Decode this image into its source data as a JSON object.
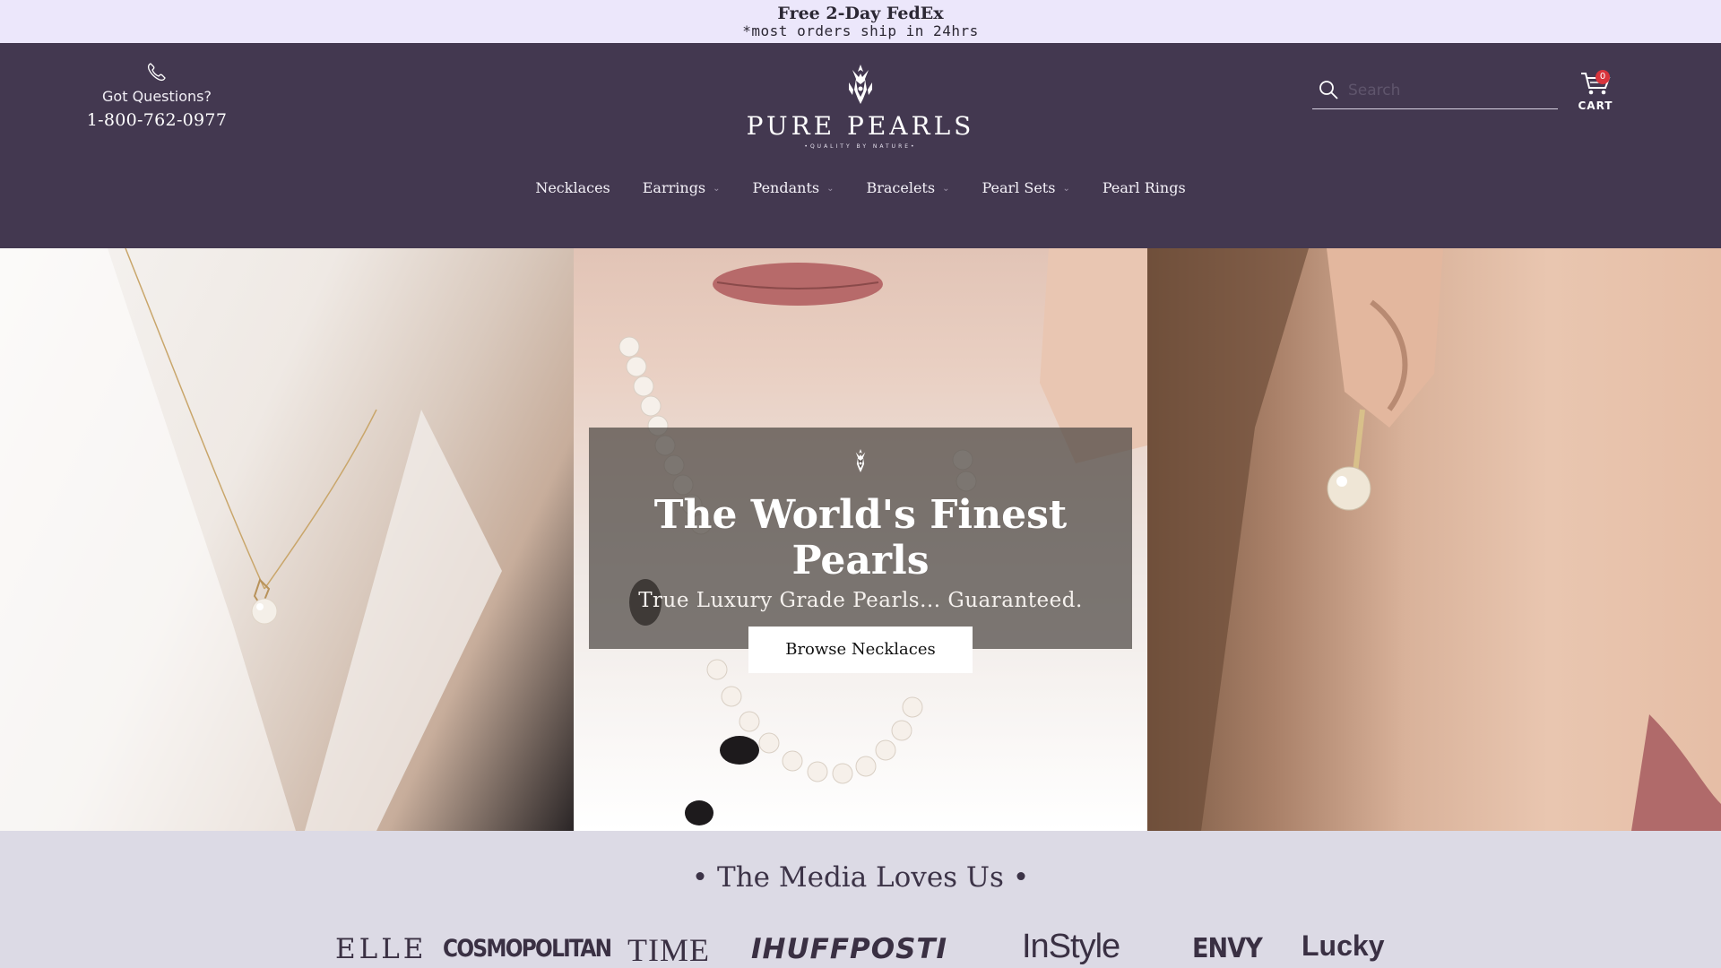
{
  "announcement": {
    "line1": "Free 2-Day FedEx",
    "line2": "*most orders ship in 24hrs"
  },
  "header": {
    "contact": {
      "icon": "phone-icon",
      "question": "Got Questions?",
      "phone": "1-800-762-0977"
    },
    "logo": {
      "brand": "PURE PEARLS",
      "tagline": "•QUALITY BY NATURE•"
    },
    "search": {
      "placeholder": "Search",
      "icon": "search-icon"
    },
    "cart": {
      "count": "0",
      "label": "CART"
    }
  },
  "nav": {
    "items": [
      {
        "label": "Necklaces",
        "has_dropdown": false
      },
      {
        "label": "Earrings",
        "has_dropdown": true
      },
      {
        "label": "Pendants",
        "has_dropdown": true
      },
      {
        "label": "Bracelets",
        "has_dropdown": true
      },
      {
        "label": "Pearl Sets",
        "has_dropdown": true
      },
      {
        "label": "Pearl Rings",
        "has_dropdown": false
      }
    ],
    "chevron": "⌄"
  },
  "hero": {
    "title": "The World's Finest Pearls",
    "subtitle": "True Luxury Grade Pearls... Guaranteed.",
    "button_label": "Browse Necklaces"
  },
  "media": {
    "heading": "• The Media Loves Us •",
    "logos": [
      "ELLE",
      "COSMOPOLITAN",
      "TIME",
      "IHUFFPOSTI",
      "InStyle",
      "ENVY",
      "Lucky"
    ]
  },
  "colors": {
    "header_bg": "#433850",
    "announce_bg": "#ece7fb",
    "media_bg": "#dcdae5",
    "badge": "#d8343c"
  }
}
